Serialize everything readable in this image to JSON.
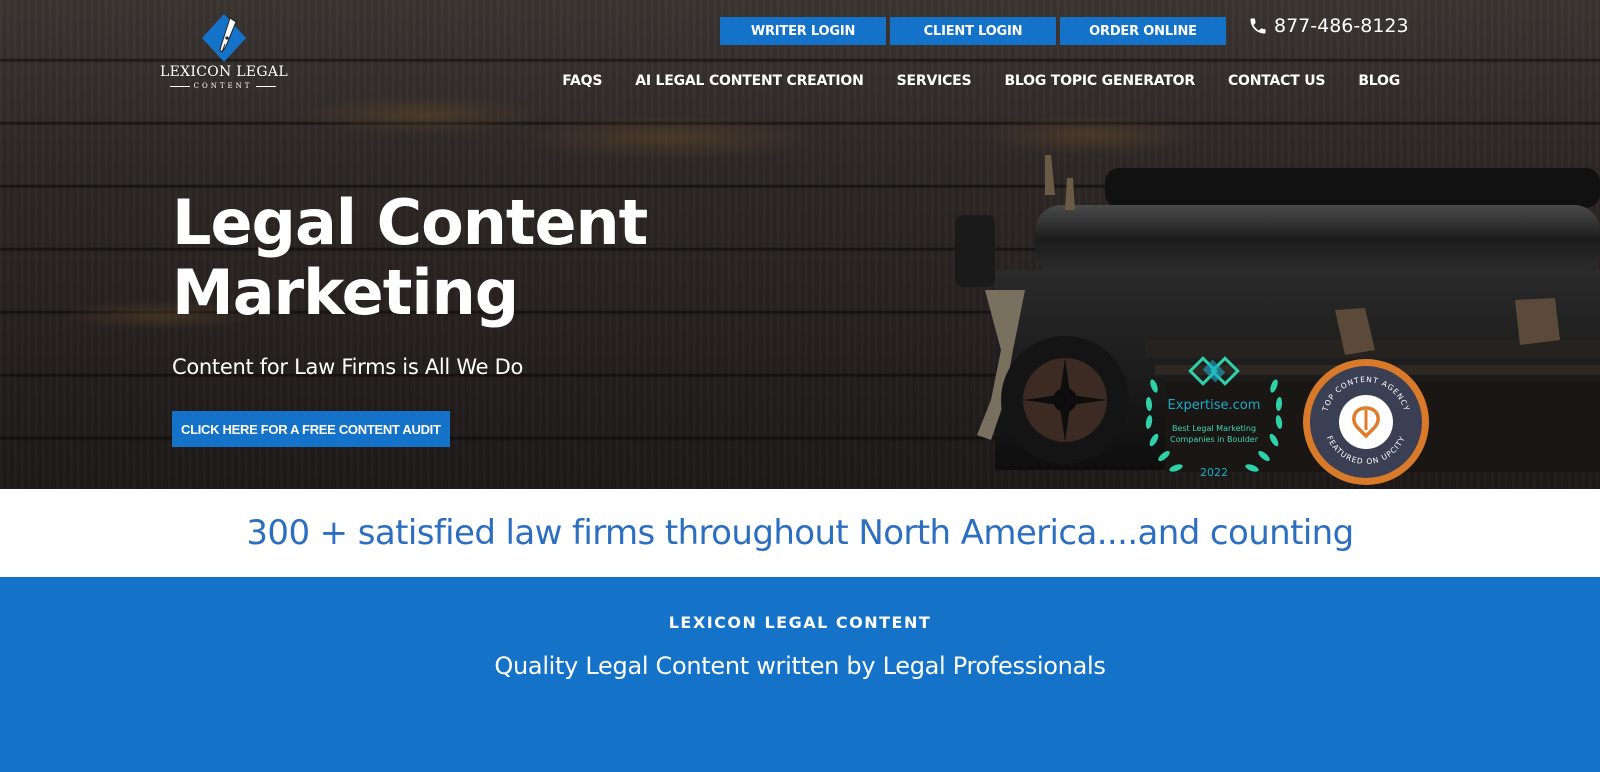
{
  "brand": {
    "logo_text": "LEXICON LEGAL",
    "logo_subtext": "CONTENT",
    "accent": "#1572c9",
    "headline_blue": "#2c6fc1"
  },
  "topbar": {
    "buttons": [
      "WRITER LOGIN",
      "CLIENT LOGIN",
      "ORDER ONLINE"
    ],
    "phone": "877-486-8123",
    "phone_icon": "phone-icon"
  },
  "nav": {
    "items": [
      "FAQS",
      "AI LEGAL CONTENT CREATION",
      "SERVICES",
      "BLOG TOPIC GENERATOR",
      "CONTACT US",
      "BLOG"
    ]
  },
  "hero": {
    "headline_line1": "Legal Content",
    "headline_line2": "Marketing",
    "subhead": "Content for Law Firms is All We Do",
    "cta": "CLICK HERE FOR A FREE CONTENT AUDIT"
  },
  "badges": {
    "expertise": {
      "name": "Expertise.com",
      "line1": "Best Legal Marketing",
      "line2": "Companies in Boulder",
      "year": "2022"
    },
    "upcity": {
      "top_text": "TOP CONTENT AGENCY",
      "bottom_text": "FEATURED ON UPCITY"
    }
  },
  "strip": {
    "text": "300 + satisfied law firms throughout North America....and counting"
  },
  "section": {
    "eyebrow": "LEXICON LEGAL CONTENT",
    "tagline": "Quality Legal Content written by Legal Professionals"
  }
}
